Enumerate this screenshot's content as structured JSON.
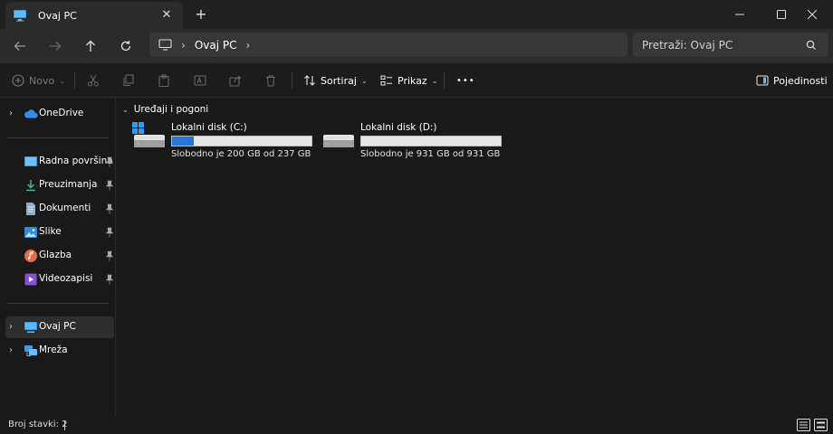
{
  "window": {
    "tab_title": "Ovaj PC",
    "tab_close": "✕",
    "new_tab": "+",
    "controls": {
      "minimize": "—",
      "maximize": "▢",
      "close": "✕"
    }
  },
  "navigation": {
    "breadcrumb": [
      "Ovaj PC"
    ],
    "search_placeholder": "Pretraži: Ovaj PC"
  },
  "toolbar": {
    "new_label": "Novo",
    "sort_label": "Sortiraj",
    "view_label": "Prikaz",
    "more_label": "•••",
    "details_label": "Pojedinosti"
  },
  "sidebar": {
    "onedrive": "OneDrive",
    "quick_access": [
      {
        "label": "Radna površina",
        "icon": "desktop-icon"
      },
      {
        "label": "Preuzimanja",
        "icon": "download-icon"
      },
      {
        "label": "Dokumenti",
        "icon": "document-icon"
      },
      {
        "label": "Slike",
        "icon": "pictures-icon"
      },
      {
        "label": "Glazba",
        "icon": "music-icon"
      },
      {
        "label": "Videozapisi",
        "icon": "video-icon"
      }
    ],
    "this_pc": "Ovaj PC",
    "network": "Mreža"
  },
  "content": {
    "group_title": "Uređaji i pogoni",
    "drives": [
      {
        "name": "Lokalni disk (C:)",
        "free_text": "Slobodno je 200 GB od 237 GB",
        "used_fraction": 0.156,
        "system": true
      },
      {
        "name": "Lokalni disk (D:)",
        "free_text": "Slobodno je 931 GB od 931 GB",
        "used_fraction": 0.0,
        "system": false
      }
    ]
  },
  "status": {
    "item_count": "Broj stavki: 2"
  },
  "colors": {
    "accent": "#2677d3",
    "background": "#191919"
  }
}
